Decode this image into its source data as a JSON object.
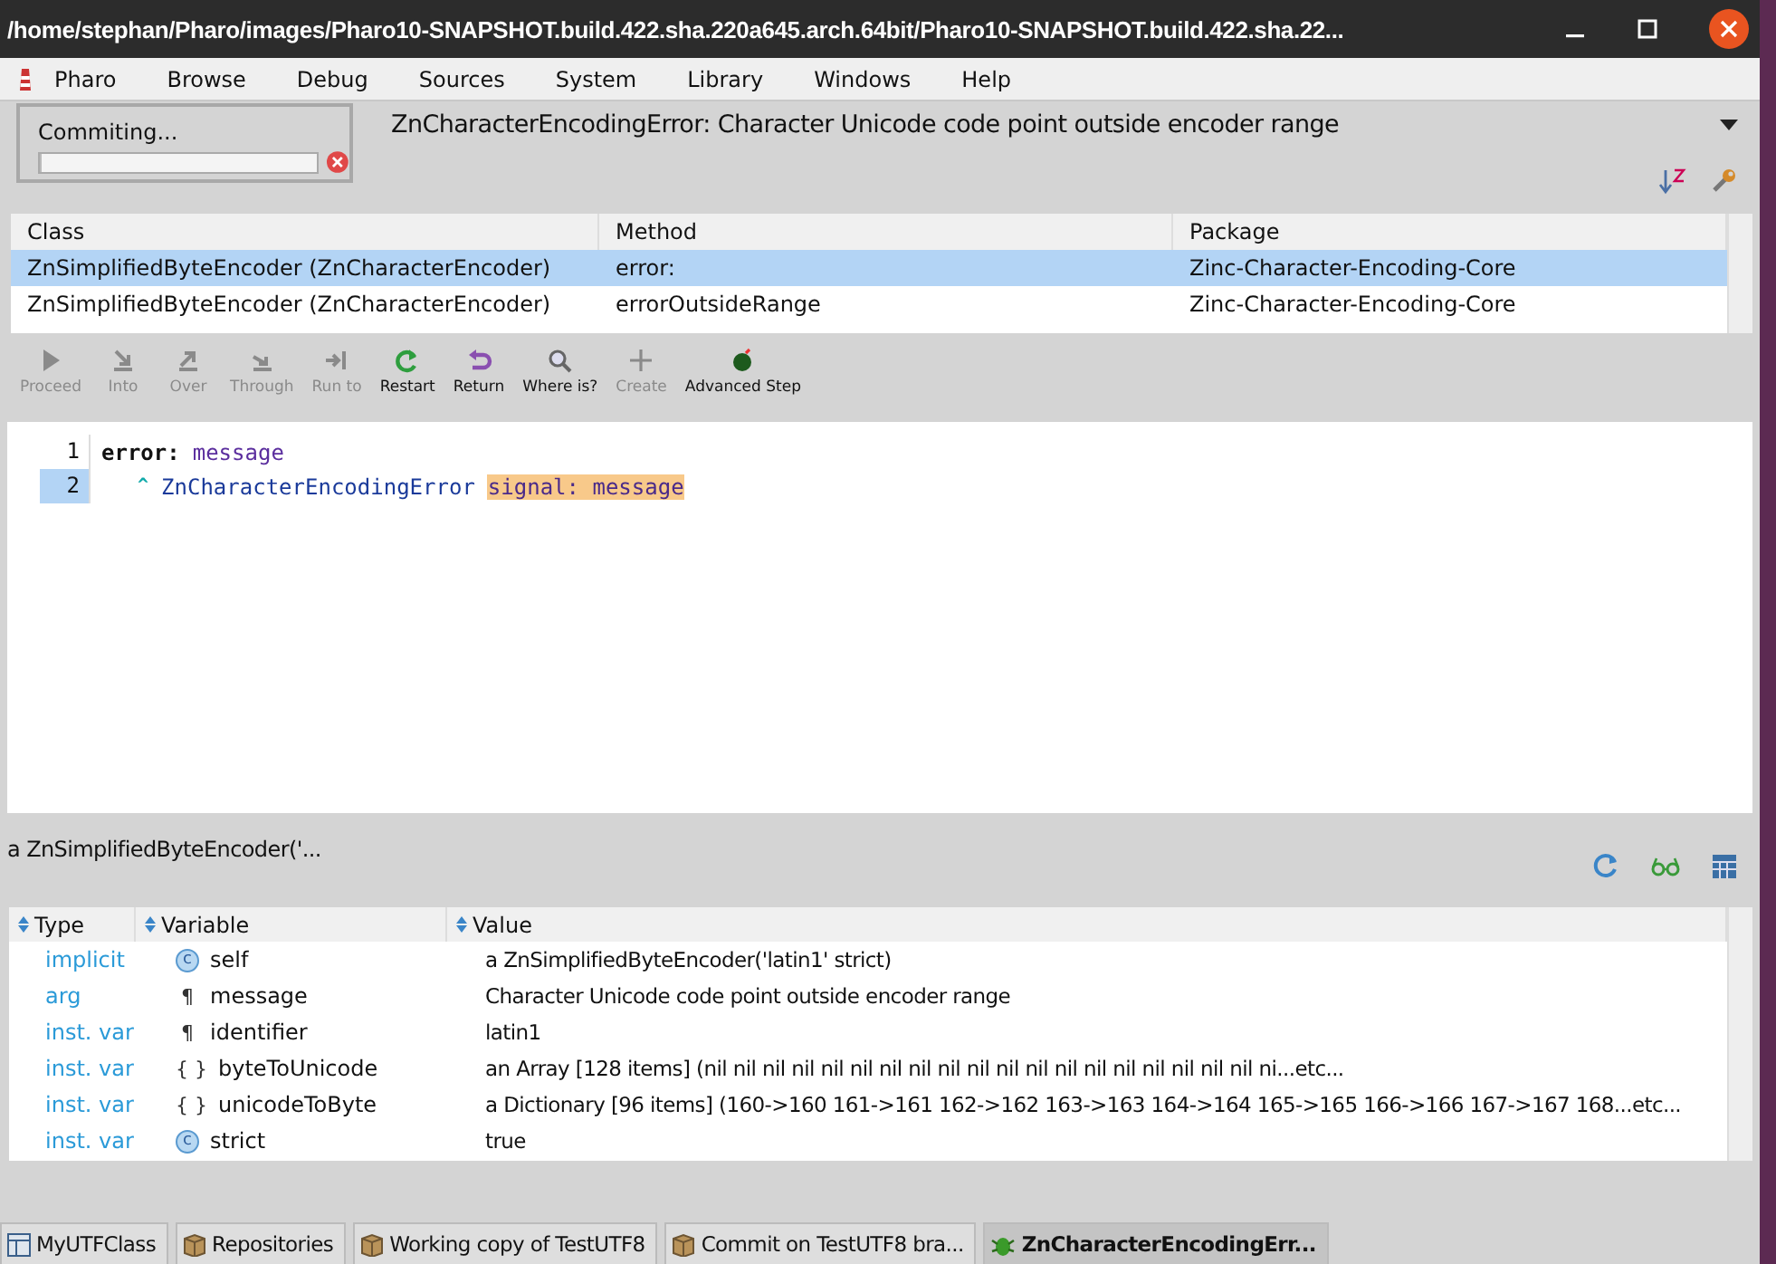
{
  "window": {
    "title": "/home/stephan/Pharo/images/Pharo10-SNAPSHOT.build.422.sha.220a645.arch.64bit/Pharo10-SNAPSHOT.build.422.sha.22..."
  },
  "menu": [
    "Pharo",
    "Browse",
    "Debug",
    "Sources",
    "System",
    "Library",
    "Windows",
    "Help"
  ],
  "progress": {
    "label": "Commiting...",
    "level": 0
  },
  "error_title": "ZnCharacterEncodingError: Character Unicode code point outside encoder range",
  "stack": {
    "columns": [
      "Class",
      "Method",
      "Package"
    ],
    "rows": [
      {
        "cells": [
          "ZnSimplifiedByteEncoder (ZnCharacterEncoder)",
          "error:",
          "Zinc-Character-Encoding-Core"
        ],
        "selected": true
      },
      {
        "cells": [
          "ZnSimplifiedByteEncoder (ZnCharacterEncoder)",
          "errorOutsideRange",
          "Zinc-Character-Encoding-Core"
        ],
        "selected": false
      }
    ]
  },
  "toolbar": [
    {
      "label": "Proceed",
      "kind": "play",
      "disabled": true
    },
    {
      "label": "Into",
      "kind": "into",
      "disabled": true
    },
    {
      "label": "Over",
      "kind": "over",
      "disabled": true
    },
    {
      "label": "Through",
      "kind": "through",
      "disabled": true
    },
    {
      "label": "Run to",
      "kind": "runto",
      "disabled": true
    },
    {
      "label": "Restart",
      "kind": "restart",
      "disabled": false
    },
    {
      "label": "Return",
      "kind": "return",
      "disabled": false
    },
    {
      "label": "Where is?",
      "kind": "search",
      "disabled": false
    },
    {
      "label": "Create",
      "kind": "plus",
      "disabled": true
    },
    {
      "label": "Advanced Step",
      "kind": "bomb",
      "disabled": false
    }
  ],
  "code": [
    {
      "number": "1",
      "selected": false,
      "tokens": [
        {
          "text": "error:",
          "kind": "keyword"
        },
        {
          "text": "message",
          "kind": "arg"
        }
      ]
    },
    {
      "number": "2",
      "selected": true,
      "tokens": [
        {
          "text": "^",
          "kind": "caret"
        },
        {
          "text": "ZnCharacterEncodingError",
          "kind": "global"
        },
        {
          "text": "signal: message",
          "kind": "highlight"
        }
      ]
    }
  ],
  "inspector": {
    "title": "a ZnSimplifiedByteEncoder('...",
    "columns": [
      "Type",
      "Variable",
      "Value"
    ],
    "rows": [
      {
        "type": "implicit",
        "marker": "c",
        "kind": "class",
        "variable": "self",
        "value": "a ZnSimplifiedByteEncoder('latin1' strict)"
      },
      {
        "type": "arg",
        "marker": "¶",
        "kind": "text",
        "variable": "message",
        "value": "Character Unicode code point outside encoder range"
      },
      {
        "type": "inst. var",
        "marker": "¶",
        "kind": "text",
        "variable": "identifier",
        "value": "latin1"
      },
      {
        "type": "inst. var",
        "marker": "{ }",
        "kind": "text",
        "variable": "byteToUnicode",
        "value": "an Array [128 items] (nil nil nil nil nil nil nil nil nil nil nil nil nil nil nil nil nil nil nil ni...etc..."
      },
      {
        "type": "inst. var",
        "marker": "{ }",
        "kind": "text",
        "variable": "unicodeToByte",
        "value": "a Dictionary [96 items] (160->160 161->161 162->162 163->163 164->164 165->165 166->166 167->167 168...etc..."
      },
      {
        "type": "inst. var",
        "marker": "c",
        "kind": "class",
        "variable": "strict",
        "value": "true"
      }
    ]
  },
  "taskbar": [
    {
      "label": "MyUTFClass",
      "kind": "browser",
      "selected": false
    },
    {
      "label": "Repositories",
      "kind": "package",
      "selected": false
    },
    {
      "label": "Working copy of TestUTF8",
      "kind": "package",
      "selected": false
    },
    {
      "label": "Commit on TestUTF8 bra...",
      "kind": "package",
      "selected": false
    },
    {
      "label": "ZnCharacterEncodingErr...",
      "kind": "bug",
      "selected": true
    }
  ]
}
